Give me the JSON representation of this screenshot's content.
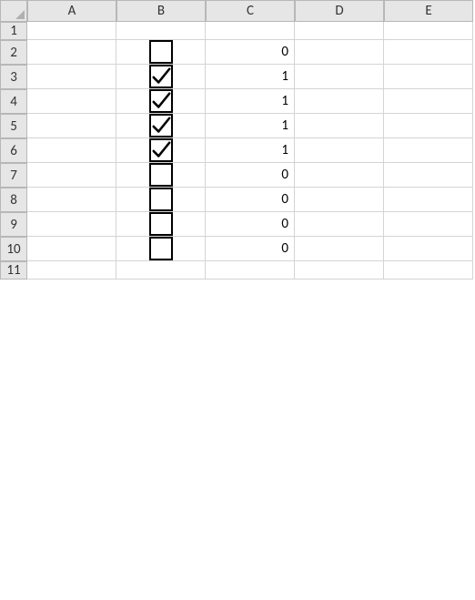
{
  "columns": [
    "A",
    "B",
    "C",
    "D",
    "E"
  ],
  "row_labels": [
    "1",
    "2",
    "3",
    "4",
    "5",
    "6",
    "7",
    "8",
    "9",
    "10",
    "11"
  ],
  "rows": [
    {
      "checkbox": null,
      "value": null
    },
    {
      "checkbox": false,
      "value": "0"
    },
    {
      "checkbox": true,
      "value": "1"
    },
    {
      "checkbox": true,
      "value": "1"
    },
    {
      "checkbox": true,
      "value": "1"
    },
    {
      "checkbox": true,
      "value": "1"
    },
    {
      "checkbox": false,
      "value": "0"
    },
    {
      "checkbox": false,
      "value": "0"
    },
    {
      "checkbox": false,
      "value": "0"
    },
    {
      "checkbox": false,
      "value": "0"
    },
    {
      "checkbox": null,
      "value": null
    }
  ]
}
